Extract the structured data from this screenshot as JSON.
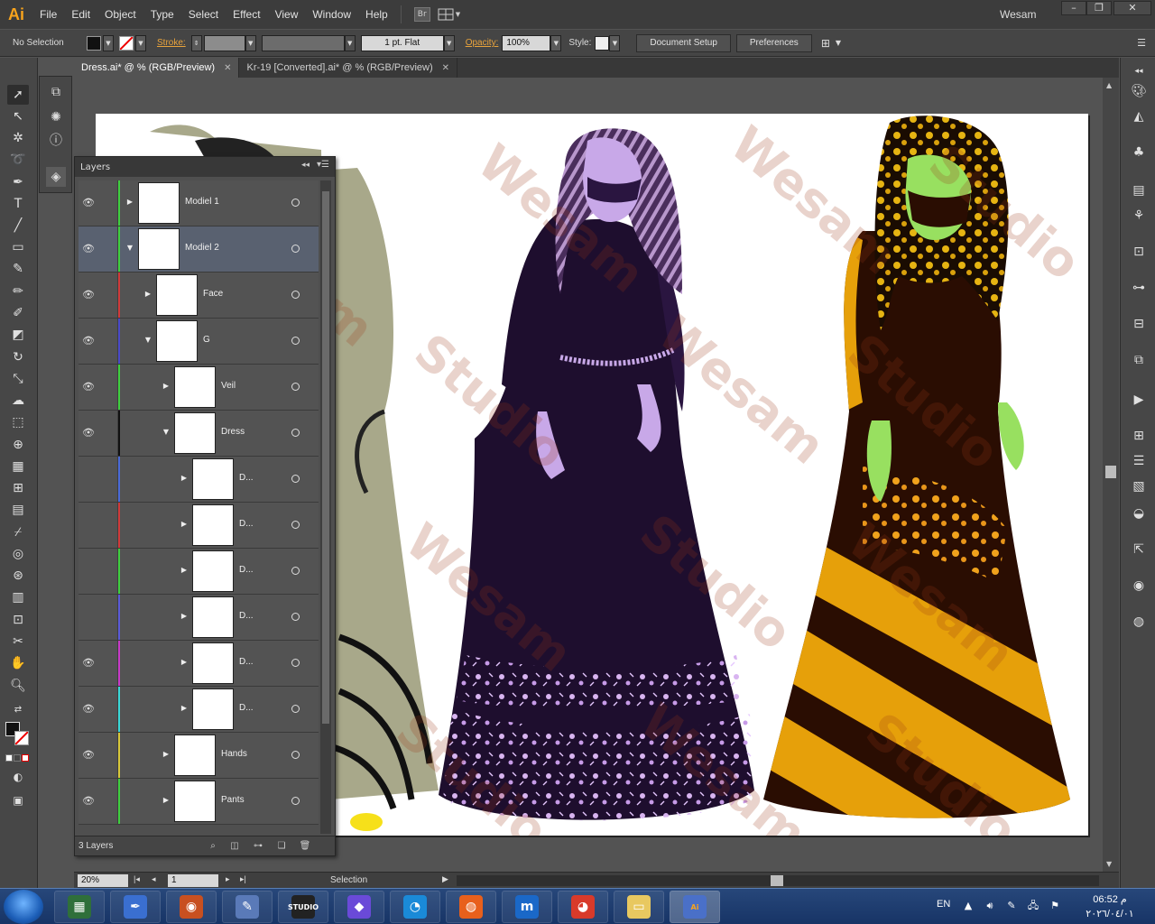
{
  "app": {
    "logo": "Ai",
    "user": "Wesam"
  },
  "menu": [
    "File",
    "Edit",
    "Object",
    "Type",
    "Select",
    "Effect",
    "View",
    "Window",
    "Help"
  ],
  "bridge_label": "Br",
  "control": {
    "selection": "No Selection",
    "stroke_label": "Stroke:",
    "brush_value": "1 pt. Flat",
    "opacity_label": "Opacity:",
    "opacity_value": "100%",
    "style_label": "Style:",
    "document_setup": "Document Setup",
    "preferences": "Preferences"
  },
  "tabs": [
    {
      "label": "Dress.ai* @ % (RGB/Preview)",
      "active": true
    },
    {
      "label": "Kr-19 [Converted].ai* @ % (RGB/Preview)",
      "active": false
    }
  ],
  "layers_panel": {
    "title": "Layers",
    "count": "3 Layers",
    "rows": [
      {
        "name": "Modiel 1",
        "level": 0,
        "expanded": false,
        "visible": true,
        "color": "#3fcf3f",
        "selected": false
      },
      {
        "name": "Modiel 2",
        "level": 0,
        "expanded": true,
        "visible": true,
        "color": "#3fcf3f",
        "selected": true
      },
      {
        "name": "Face",
        "level": 1,
        "expanded": false,
        "visible": true,
        "color": "#d03a3a",
        "selected": false
      },
      {
        "name": "G",
        "level": 1,
        "expanded": true,
        "visible": true,
        "color": "#4a4ac8",
        "selected": false
      },
      {
        "name": "Veil",
        "level": 2,
        "expanded": false,
        "visible": true,
        "color": "#3fcf3f",
        "selected": false
      },
      {
        "name": "Dress",
        "level": 2,
        "expanded": true,
        "visible": true,
        "color": "#111111",
        "selected": false
      },
      {
        "name": "D...",
        "level": 3,
        "expanded": false,
        "visible": false,
        "color": "#4a6ad8",
        "selected": false
      },
      {
        "name": "D...",
        "level": 3,
        "expanded": false,
        "visible": false,
        "color": "#d03a3a",
        "selected": false
      },
      {
        "name": "D...",
        "level": 3,
        "expanded": false,
        "visible": false,
        "color": "#3fcf3f",
        "selected": false
      },
      {
        "name": "D...",
        "level": 3,
        "expanded": false,
        "visible": false,
        "color": "#5a5ad8",
        "selected": false
      },
      {
        "name": "D...",
        "level": 3,
        "expanded": false,
        "visible": true,
        "color": "#c83ac8",
        "selected": false
      },
      {
        "name": "D...",
        "level": 3,
        "expanded": false,
        "visible": true,
        "color": "#3ad8d8",
        "selected": false
      },
      {
        "name": "Hands",
        "level": 2,
        "expanded": false,
        "visible": true,
        "color": "#d8c83a",
        "selected": false
      },
      {
        "name": "Pants",
        "level": 2,
        "expanded": false,
        "visible": true,
        "color": "#3fcf3f",
        "selected": false
      }
    ]
  },
  "status": {
    "zoom": "20%",
    "page": "1",
    "tool": "Selection"
  },
  "taskbar": {
    "apps": [
      "",
      "",
      "",
      "",
      "STUDIO",
      "",
      "",
      "",
      "",
      "",
      "",
      "Ai"
    ],
    "lang": "EN",
    "time": "06:52 م",
    "date": "٢٠٢٦/٠٤/٠١"
  },
  "colors": {
    "accent": "#f7a31c",
    "dress_purple": "#1e0e2e",
    "dress_brown": "#2a0d02",
    "stripe_gold": "#e6a00a",
    "skin_lilac": "#c8a8e8",
    "skin_green": "#98e060"
  }
}
